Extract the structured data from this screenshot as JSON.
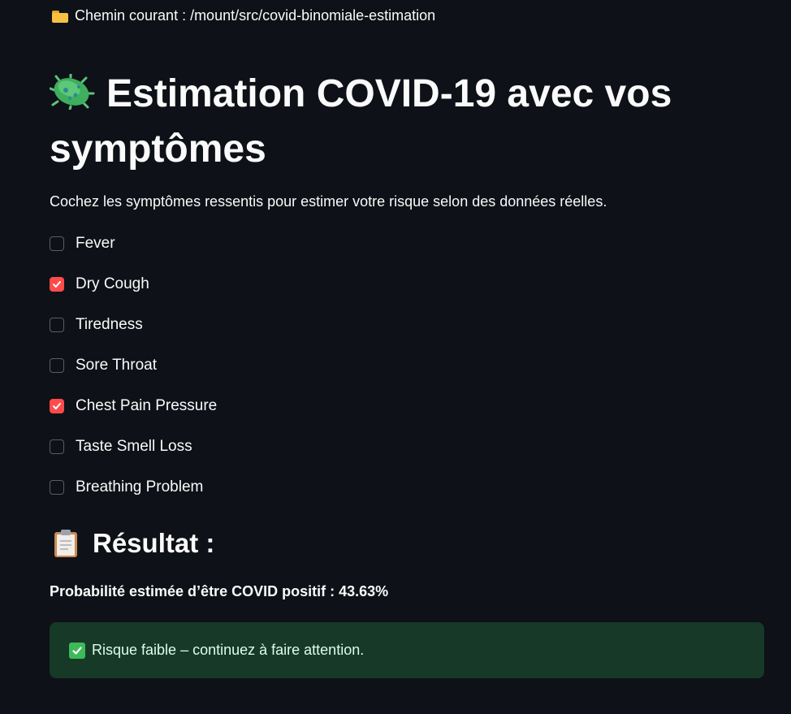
{
  "header": {
    "folder_icon": "open-folder-icon",
    "path_label": "Chemin courant : /mount/src/covid-binomiale-estimation"
  },
  "title": {
    "icon": "microbe-icon",
    "text": "Estimation COVID-19 avec vos symptômes"
  },
  "subtitle": "Cochez les symptômes ressentis pour estimer votre risque selon des données réelles.",
  "symptoms": [
    {
      "label": "Fever",
      "checked": false
    },
    {
      "label": "Dry Cough",
      "checked": true
    },
    {
      "label": "Tiredness",
      "checked": false
    },
    {
      "label": "Sore Throat",
      "checked": false
    },
    {
      "label": "Chest Pain Pressure",
      "checked": true
    },
    {
      "label": "Taste Smell Loss",
      "checked": false
    },
    {
      "label": "Breathing Problem",
      "checked": false
    }
  ],
  "result": {
    "icon": "clipboard-icon",
    "heading": "Résultat :",
    "probability_text": "Probabilité estimée d’être COVID positif : 43.63%"
  },
  "alert": {
    "icon": "check-mark-icon",
    "message": "Risque faible – continuez à faire attention."
  },
  "colors": {
    "background": "#0e1117",
    "checkbox_checked": "#ff4b4b",
    "success_bg": "#173928",
    "success_text": "#dffde9"
  }
}
